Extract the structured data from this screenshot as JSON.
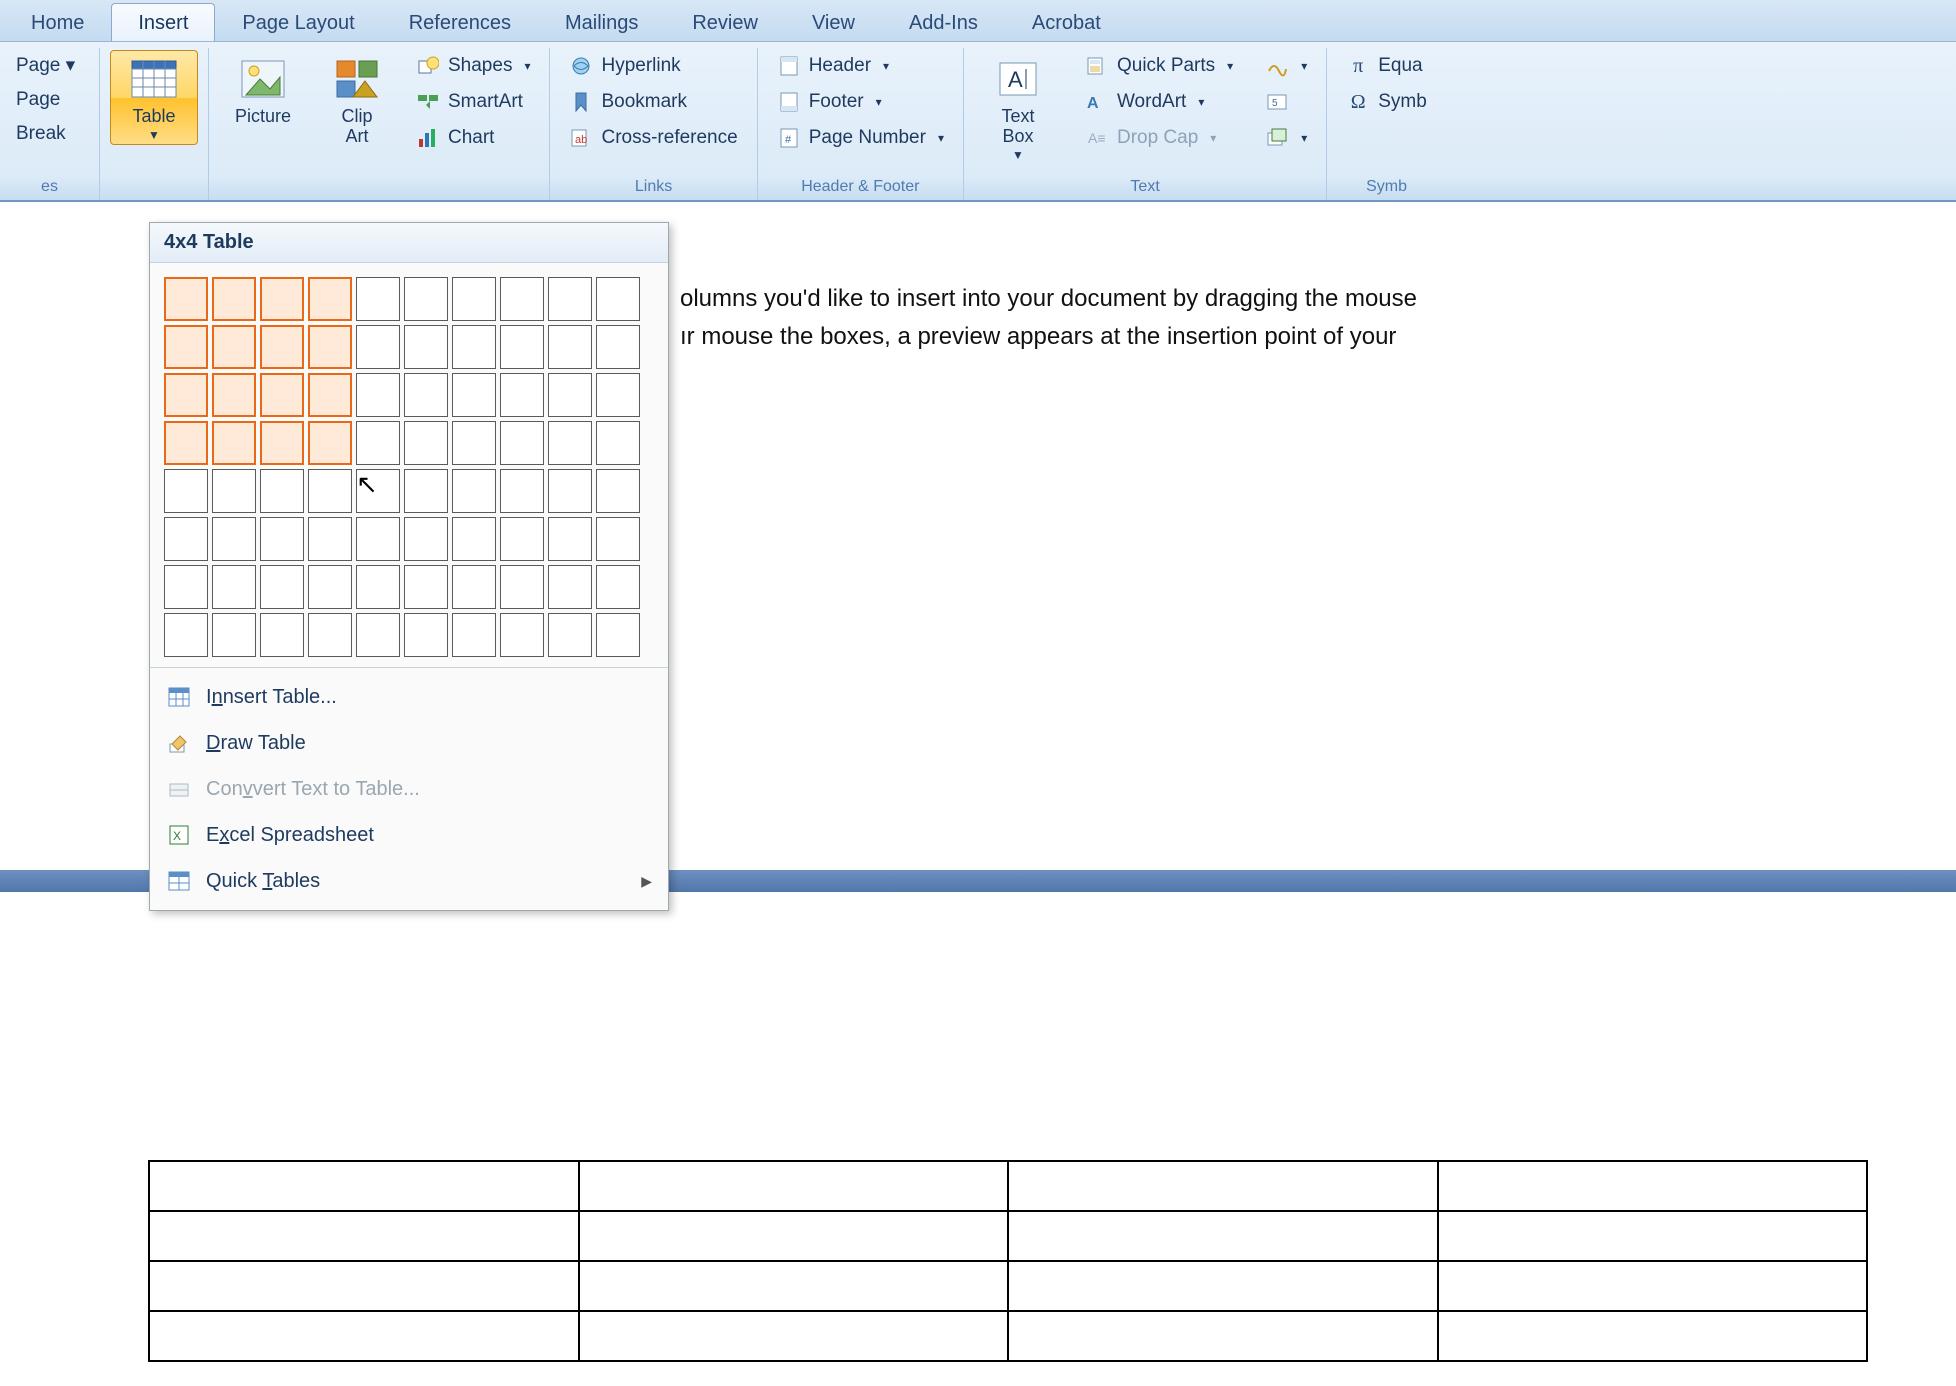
{
  "tabs": {
    "home": "Home",
    "insert": "Insert",
    "pageLayout": "Page Layout",
    "references": "References",
    "mailings": "Mailings",
    "review": "Review",
    "view": "View",
    "addins": "Add-Ins",
    "acrobat": "Acrobat"
  },
  "ribbon": {
    "pages": {
      "line1": "Page ▾",
      "line2": "Page",
      "line3": "Break",
      "groupTitle": "es"
    },
    "tables": {
      "table": "Table",
      "groupTitle": " "
    },
    "illustrations": {
      "picture": "Picture",
      "clipart": "Clip\nArt",
      "shapes": "Shapes",
      "smartart": "SmartArt",
      "chart": "Chart",
      "groupTitle": " "
    },
    "links": {
      "hyperlink": "Hyperlink",
      "bookmark": "Bookmark",
      "crossref": "Cross-reference",
      "groupTitle": "Links"
    },
    "hf": {
      "header": "Header",
      "footer": "Footer",
      "pagenum": "Page Number",
      "groupTitle": "Header & Footer"
    },
    "text": {
      "textbox": "Text\nBox",
      "quickparts": "Quick Parts",
      "wordart": "WordArt",
      "dropcap": "Drop Cap",
      "groupTitle": "Text"
    },
    "symbols": {
      "equation": "Equa",
      "symbol": "Symb",
      "groupTitle": "Symb"
    }
  },
  "tableDropdown": {
    "title": "4x4 Table",
    "gridCols": 10,
    "gridRows": 8,
    "selCols": 4,
    "selRows": 4,
    "menu": {
      "insertTable": "nsert Table...",
      "drawTable": "raw Table",
      "convert": "vert Text to Table...",
      "excel": "cel Spreadsheet",
      "quickTables": "ables"
    }
  },
  "docText": {
    "l1": "olumns you'd like to insert into your document by dragging the mouse",
    "l2": "ır mouse the boxes, a preview appears at the insertion point of your"
  },
  "previewTable": {
    "rows": 4,
    "cols": 4
  }
}
